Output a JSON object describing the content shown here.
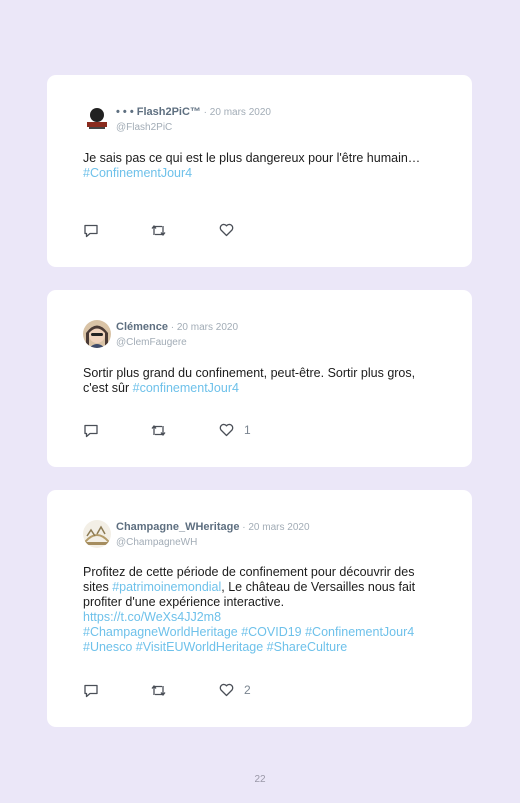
{
  "tweets": [
    {
      "name": "• • • Flash2PiC™",
      "sep": " · ",
      "date": "20 mars 2020",
      "handle": "@Flash2PiC",
      "text_parts": [
        "Je sais pas ce qui est le plus dangereux pour l'être humain…",
        "#ConfinementJour4"
      ],
      "likes": ""
    },
    {
      "name": "Clémence",
      "sep": " · ",
      "date": "20 mars 2020",
      "handle": "@ClemFaugere",
      "text_parts": [
        "Sortir plus grand du confinement, peut-être. Sortir plus gros, c'est sûr ",
        "#confinementJour4"
      ],
      "likes": "1"
    },
    {
      "name": "Champagne_WHeritage",
      "sep": " · ",
      "date": "20 mars 2020",
      "handle": "@ChampagneWH",
      "text_parts": [
        "Profitez de cette période de confinement pour découvrir des sites ",
        "#patrimoinemondial",
        ", Le château de Versailles nous fait profiter d'une expérience interactive.",
        "https://t.co/WeXs4JJ2m8",
        "#ChampagneWorldHeritage #COVID19 #ConfinementJour4",
        "#Unesco #VisitEUWorldHeritage #ShareCulture"
      ],
      "likes": "2"
    }
  ],
  "icons": [
    "reply-icon",
    "retweet-icon",
    "like-icon"
  ],
  "colors": {
    "background": "#ebe7f8",
    "card": "#ffffff",
    "link": "#6ec1ea",
    "name": "#5e6f80",
    "meta": "#a2acb6"
  },
  "page_number": "22"
}
